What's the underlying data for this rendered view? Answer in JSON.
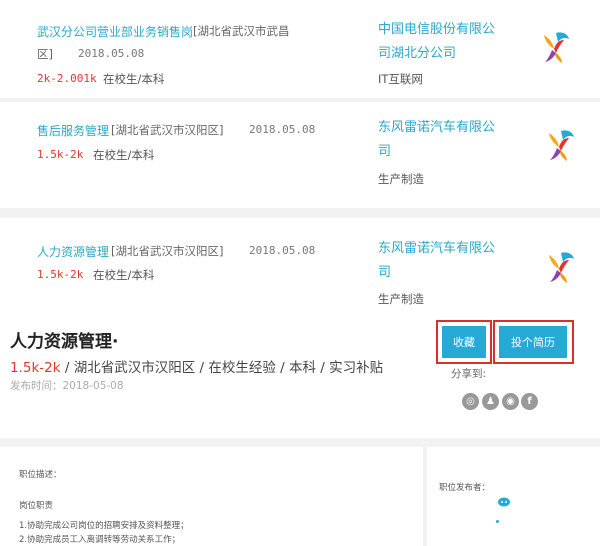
{
  "jobs": [
    {
      "title": "武汉分公司营业部业务销售岗",
      "location_line1": "[湖北省武汉市武昌",
      "location_line2": "区]",
      "date": "2018.05.08",
      "salary": "2k-2.001k",
      "requirements": "在校生/本科",
      "company_line1": "中国电信股份有限公",
      "company_line2": "司湖北分公司",
      "industry": "IT互联网"
    },
    {
      "title": "售后服务管理",
      "location": "[湖北省武汉市汉阳区]",
      "date": "2018.05.08",
      "salary": "1.5k-2k",
      "requirements": "在校生/本科",
      "company_line1": "东风雷诺汽车有限公",
      "company_line2": "司",
      "industry": "生产制造"
    },
    {
      "title": "人力资源管理",
      "location": "[湖北省武汉市汉阳区]",
      "date": "2018.05.08",
      "salary": "1.5k-2k",
      "requirements": "在校生/本科",
      "company_line1": "东风雷诺汽车有限公",
      "company_line2": "司",
      "industry": "生产制造"
    }
  ],
  "detail": {
    "title": "人力资源管理·",
    "salary": "1.5k-2k",
    "info": " / 湖北省武汉市汉阳区 / 在校生经验 / 本科 / 实习补贴",
    "publish_date": "发布时间：2018-05-08",
    "favorite_label": "收藏",
    "apply_label": "投个简历",
    "share_label": "分享到:",
    "accent_color": "#27a9d6",
    "highlight_color": "#d9302a"
  },
  "description": {
    "heading": "职位描述：",
    "subheading": "岗位职责",
    "item1": "1.协助完成公司岗位的招聘安排及资料整理；",
    "item2": "2.协助完成员工入离调转等劳动关系工作；"
  },
  "publisher": {
    "heading": "职位发布者："
  }
}
